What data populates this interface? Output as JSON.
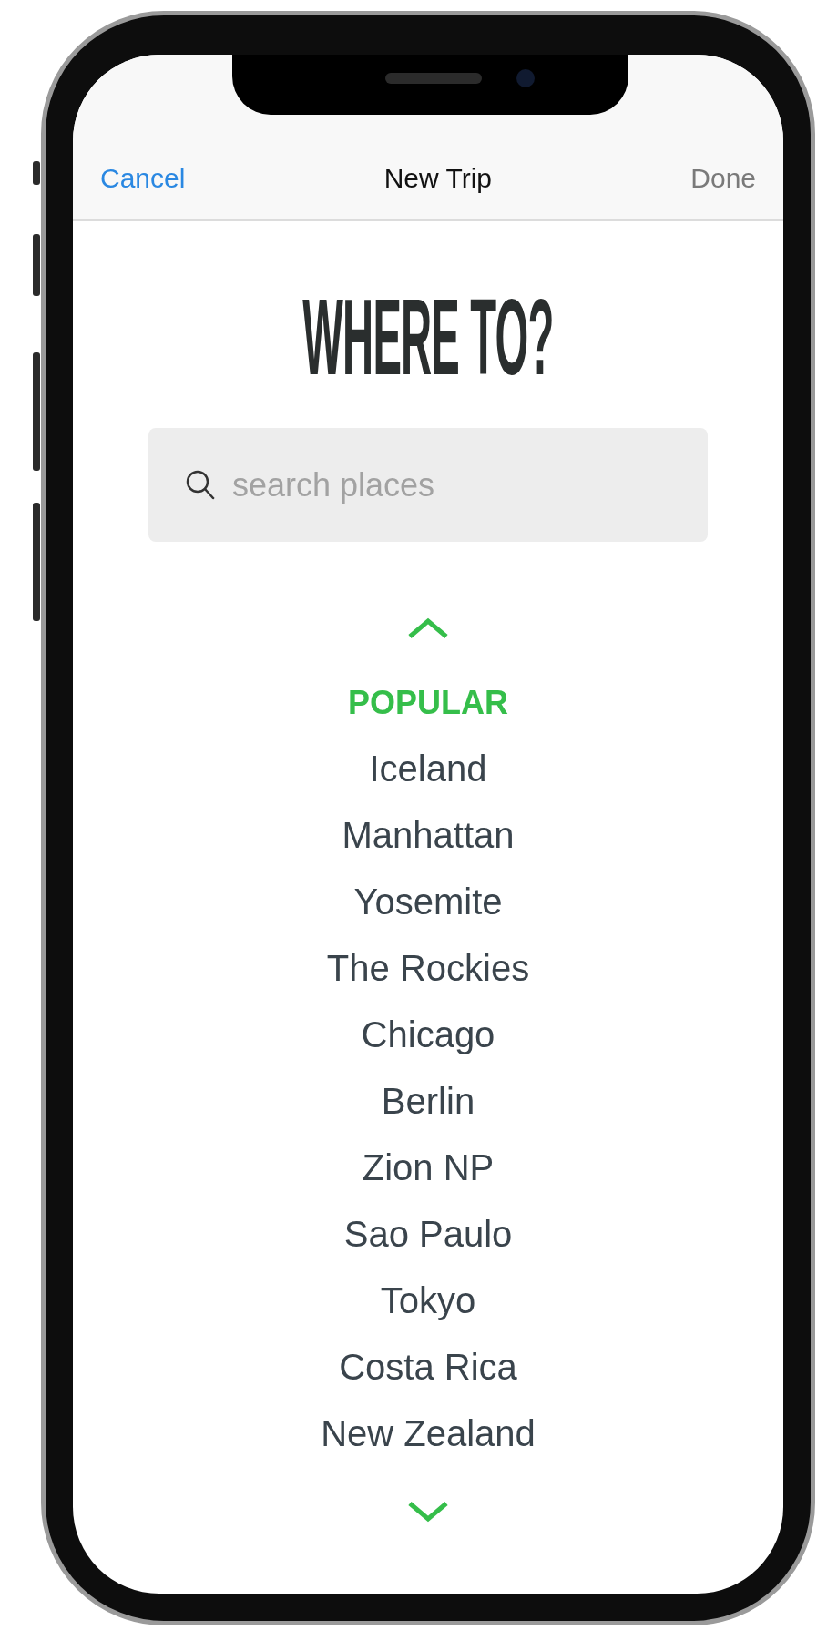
{
  "nav": {
    "cancel": "Cancel",
    "title": "New Trip",
    "done": {
      "label": "Done",
      "disabled": true
    }
  },
  "heading": "WHERE TO?",
  "search": {
    "placeholder": "search places"
  },
  "list": {
    "section": "POPULAR",
    "items": [
      {
        "label": "Iceland"
      },
      {
        "label": "Manhattan"
      },
      {
        "label": "Yosemite"
      },
      {
        "label": "The Rockies"
      },
      {
        "label": "Chicago"
      },
      {
        "label": "Berlin"
      },
      {
        "label": "Zion NP"
      },
      {
        "label": "Sao Paulo"
      },
      {
        "label": "Tokyo"
      },
      {
        "label": "Costa Rica"
      },
      {
        "label": "New Zealand"
      }
    ]
  }
}
